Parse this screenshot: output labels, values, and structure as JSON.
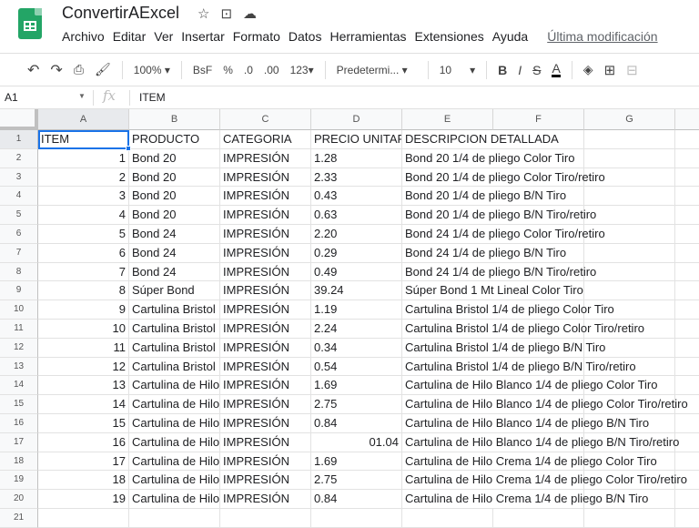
{
  "app": {
    "title": "ConvertirAExcel",
    "accent": "#23a566"
  },
  "menu": [
    "Archivo",
    "Editar",
    "Ver",
    "Insertar",
    "Formato",
    "Datos",
    "Herramientas",
    "Extensiones",
    "Ayuda"
  ],
  "last_edit": "Última modificación",
  "toolbar": {
    "zoom": "100%",
    "currency": "BsF",
    "percent": "%",
    "dec_less": ".0",
    "dec_more": ".00",
    "format": "123",
    "font": "Predetermi...",
    "size": "10",
    "bold": "B",
    "italic": "I",
    "strike": "S",
    "text_color": "A"
  },
  "formula_bar": {
    "cell_ref": "A1",
    "fx": "fx",
    "value": "ITEM"
  },
  "columns": [
    "A",
    "B",
    "C",
    "D",
    "E",
    "F",
    "G"
  ],
  "header": [
    "ITEM",
    "PRODUCTO",
    "CATEGORIA",
    "PRECIO UNITARIO",
    "DESCRIPCION DETALLADA"
  ],
  "rows": [
    [
      "1",
      "Bond 20",
      "IMPRESIÓN",
      "1.28",
      "Bond 20 1/4 de pliego Color Tiro"
    ],
    [
      "2",
      "Bond 20",
      "IMPRESIÓN",
      "2.33",
      "Bond 20 1/4 de pliego Color Tiro/retiro"
    ],
    [
      "3",
      "Bond 20",
      "IMPRESIÓN",
      "0.43",
      "Bond 20 1/4 de pliego B/N Tiro"
    ],
    [
      "4",
      "Bond 20",
      "IMPRESIÓN",
      "0.63",
      "Bond 20 1/4 de pliego B/N Tiro/retiro"
    ],
    [
      "5",
      "Bond 24",
      "IMPRESIÓN",
      "2.20",
      "Bond 24 1/4 de pliego Color Tiro/retiro"
    ],
    [
      "6",
      "Bond 24",
      "IMPRESIÓN",
      "0.29",
      "Bond 24 1/4 de pliego B/N Tiro"
    ],
    [
      "7",
      "Bond 24",
      "IMPRESIÓN",
      "0.49",
      "Bond 24 1/4 de pliego B/N Tiro/retiro"
    ],
    [
      "8",
      "Súper Bond",
      "IMPRESIÓN",
      "39.24",
      "Súper Bond 1 Mt Lineal Color Tiro"
    ],
    [
      "9",
      "Cartulina Bristol",
      "IMPRESIÓN",
      "1.19",
      "Cartulina Bristol 1/4 de pliego Color Tiro"
    ],
    [
      "10",
      "Cartulina Bristol",
      "IMPRESIÓN",
      "2.24",
      "Cartulina Bristol 1/4 de pliego Color Tiro/retiro"
    ],
    [
      "11",
      "Cartulina Bristol",
      "IMPRESIÓN",
      "0.34",
      "Cartulina Bristol 1/4 de pliego B/N Tiro"
    ],
    [
      "12",
      "Cartulina Bristol",
      "IMPRESIÓN",
      "0.54",
      "Cartulina Bristol 1/4 de pliego B/N Tiro/retiro"
    ],
    [
      "13",
      "Cartulina de Hilo",
      "IMPRESIÓN",
      "1.69",
      "Cartulina de Hilo Blanco 1/4 de pliego Color Tiro"
    ],
    [
      "14",
      "Cartulina de Hilo",
      "IMPRESIÓN",
      "2.75",
      "Cartulina de Hilo Blanco 1/4 de pliego Color Tiro/retiro"
    ],
    [
      "15",
      "Cartulina de Hilo",
      "IMPRESIÓN",
      "0.84",
      "Cartulina de Hilo Blanco 1/4 de pliego B/N Tiro"
    ],
    [
      "16",
      "Cartulina de Hilo",
      "IMPRESIÓN",
      "01.04",
      "Cartulina de Hilo Blanco 1/4 de pliego B/N Tiro/retiro"
    ],
    [
      "17",
      "Cartulina de Hilo",
      "IMPRESIÓN",
      "1.69",
      "Cartulina de Hilo Crema 1/4 de pliego Color Tiro"
    ],
    [
      "18",
      "Cartulina de Hilo",
      "IMPRESIÓN",
      "2.75",
      "Cartulina de Hilo Crema 1/4 de pliego Color Tiro/retiro"
    ],
    [
      "19",
      "Cartulina de Hilo",
      "IMPRESIÓN",
      "0.84",
      "Cartulina de Hilo Crema 1/4 de pliego B/N Tiro"
    ]
  ],
  "right_aligned_price_rows": [
    16
  ]
}
